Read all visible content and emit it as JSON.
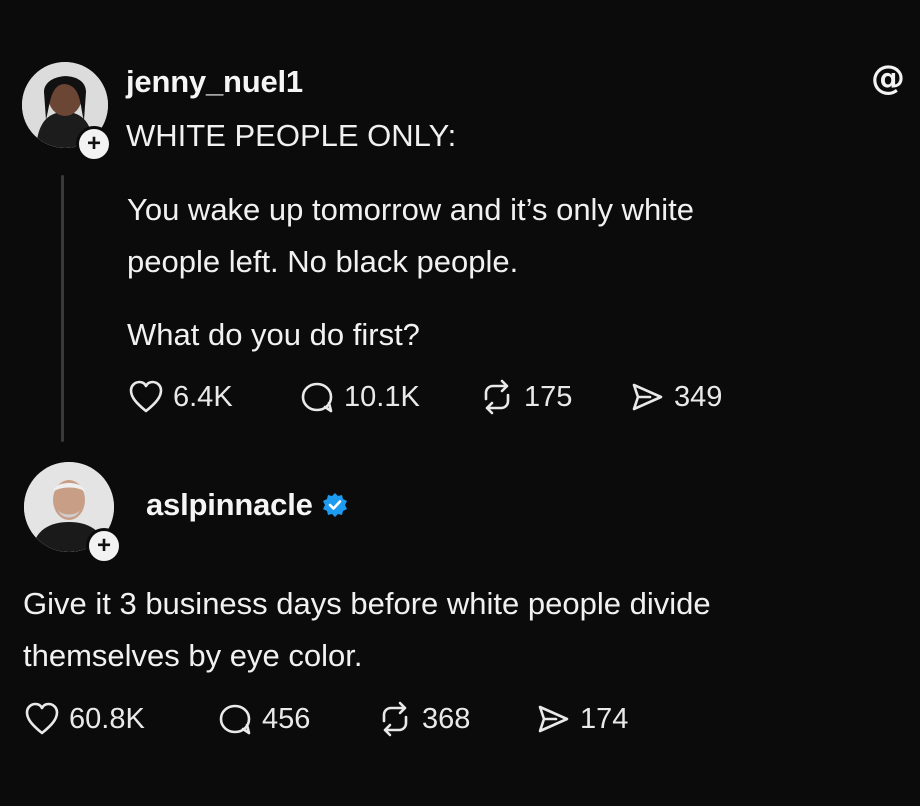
{
  "post": {
    "username": "jenny_nuel1",
    "headline": "WHITE PEOPLE ONLY:",
    "paragraph1_line1": "You wake up tomorrow and it’s only white",
    "paragraph1_line2": "people left. No black people.",
    "paragraph2": "What do you do first?",
    "stats": {
      "likes": "6.4K",
      "replies": "10.1K",
      "reposts": "175",
      "shares": "349"
    }
  },
  "reply": {
    "username": "aslpinnacle",
    "verified": true,
    "line1": "Give it 3 business days before white people divide",
    "line2": "themselves by eye color.",
    "stats": {
      "likes": "60.8K",
      "replies": "456",
      "reposts": "368",
      "shares": "174"
    }
  },
  "icons": {
    "app": "threads-logo-icon",
    "like": "heart-icon",
    "reply": "comment-icon",
    "repost": "repost-icon",
    "share": "send-icon",
    "verified": "verified-badge-icon",
    "follow": "plus-icon"
  },
  "colors": {
    "background": "#0b0b0b",
    "text": "#f3f3f3",
    "verified": "#1d9bf0",
    "thread_line": "#3a3a3a"
  }
}
